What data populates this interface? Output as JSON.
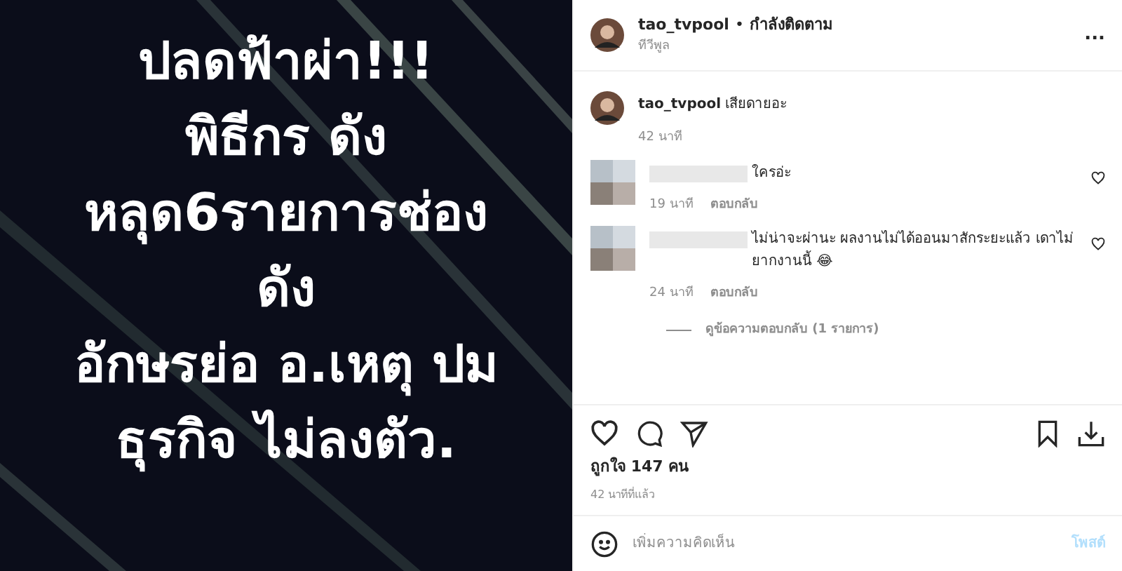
{
  "post_image": {
    "lines": [
      "ปลดฟ้าผ่า!!!",
      "พิธีกร ดัง",
      "หลุด6รายการช่อง",
      "ดัง",
      "อักษรย่อ อ.เหตุ ปม",
      "ธุรกิจ ไม่ลงตัว."
    ]
  },
  "header": {
    "username": "tao_tvpool",
    "separator": "•",
    "follow": "กำลังติดตาม",
    "location": "ทีวีพูล",
    "more": "..."
  },
  "caption": {
    "username": "tao_tvpool",
    "text": "เสียดายอะ",
    "time": "42 นาที"
  },
  "comments": [
    {
      "text": "ใครอ่ะ",
      "time": "19 นาที",
      "reply": "ตอบกลับ",
      "liked": false
    },
    {
      "text": "ไม่น่าจะผ่านะ ผลงานไม่ได้ออนมาสักระยะแล้ว เดาไม่ยากงานนี้ 😂",
      "time": "24 นาที",
      "reply": "ตอบกลับ",
      "liked": false,
      "view_replies": "ดูข้อความตอบกลับ (1 รายการ)"
    }
  ],
  "likes": "ถูกใจ 147 คน",
  "posted": "42 นาทีที่แล้ว",
  "comment_box": {
    "placeholder": "เพิ่มความคิดเห็น",
    "post": "โพสต์"
  }
}
